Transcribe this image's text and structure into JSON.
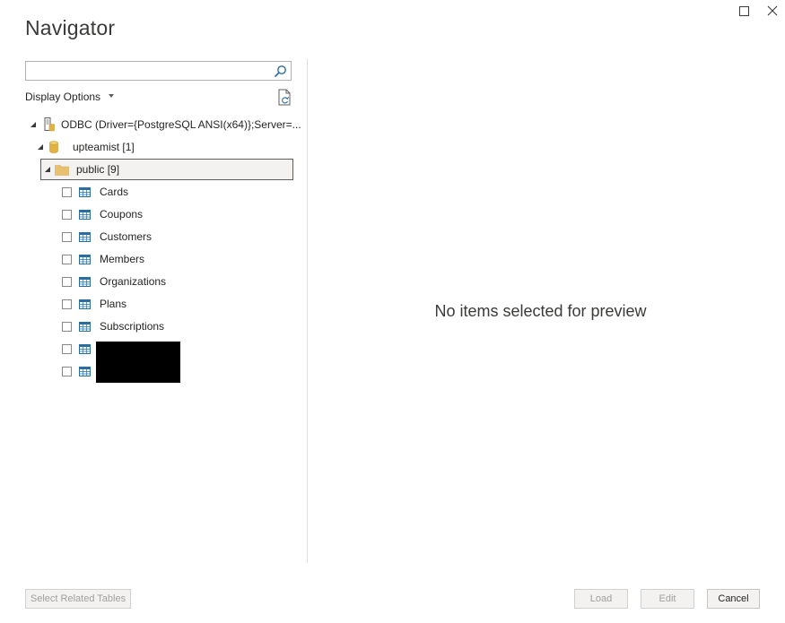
{
  "window": {
    "title": "Navigator",
    "maximize_icon": "maximize-icon",
    "close_icon": "close-icon"
  },
  "search": {
    "value": "",
    "placeholder": "",
    "icon": "search-icon"
  },
  "display_options": {
    "label": "Display Options",
    "icon": "chevron-down-icon"
  },
  "refresh_icon": "refresh-document-icon",
  "tree": {
    "root": {
      "label": "ODBC (Driver={PostgreSQL ANSI(x64)};Server=...",
      "icon": "odbc-server-icon"
    },
    "database": {
      "label": "upteamist [1]",
      "icon": "database-icon"
    },
    "schema": {
      "label": "public [9]",
      "icon": "folder-icon"
    },
    "tables": [
      {
        "label": "Cards",
        "checked": false
      },
      {
        "label": "Coupons",
        "checked": false
      },
      {
        "label": "Customers",
        "checked": false
      },
      {
        "label": "Members",
        "checked": false
      },
      {
        "label": "Organizations",
        "checked": false
      },
      {
        "label": "Plans",
        "checked": false
      },
      {
        "label": "Subscriptions",
        "checked": false
      },
      {
        "label": "",
        "checked": false
      },
      {
        "label": "",
        "checked": false
      }
    ]
  },
  "preview": {
    "message": "No items selected for preview"
  },
  "footer": {
    "select_related": "Select Related Tables",
    "load": "Load",
    "edit": "Edit",
    "cancel": "Cancel"
  },
  "colors": {
    "accent_table": "#2b6ca3",
    "folder": "#e8c170",
    "database": "#e3b341"
  }
}
